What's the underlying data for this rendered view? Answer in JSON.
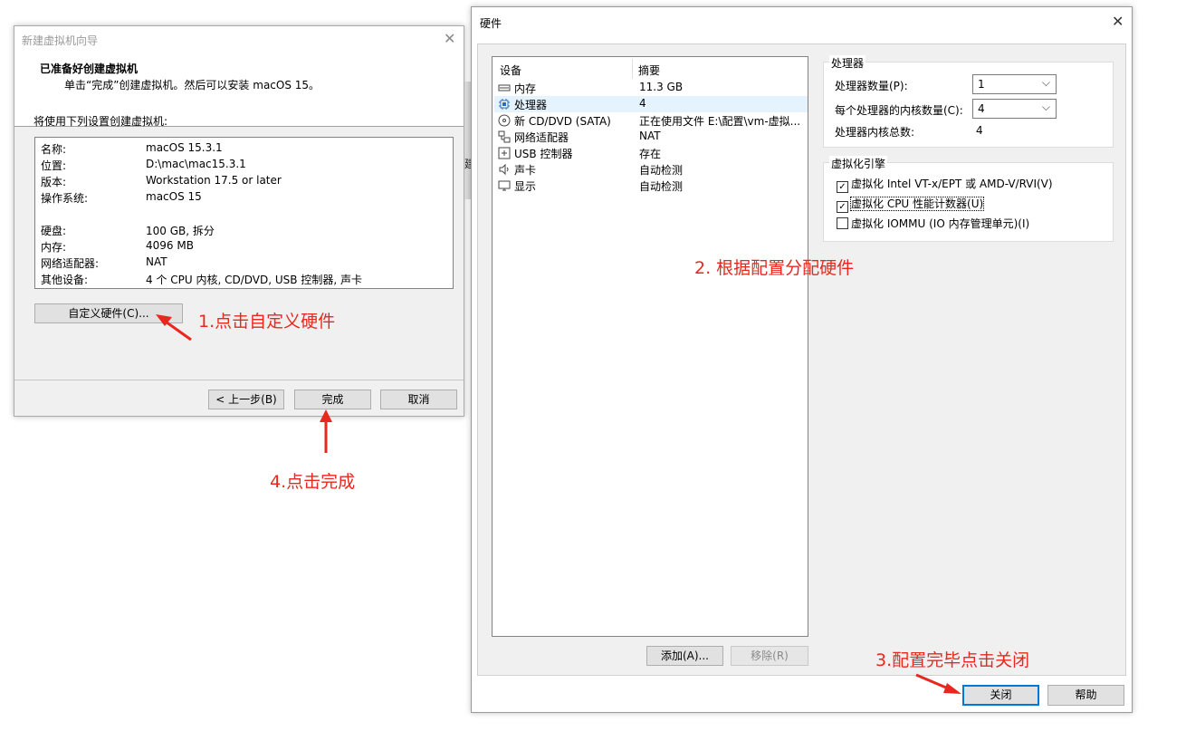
{
  "wizard": {
    "title": "新建虚拟机向导",
    "header_title": "已准备好创建虚拟机",
    "header_subtitle": "单击“完成”创建虚拟机。然后可以安装 macOS 15。",
    "prompt": "将使用下列设置创建虚拟机:",
    "settings": [
      {
        "key": "名称:",
        "value": "macOS 15.3.1"
      },
      {
        "key": "位置:",
        "value": "D:\\mac\\mac15.3.1"
      },
      {
        "key": "版本:",
        "value": "Workstation 17.5 or later"
      },
      {
        "key": "操作系统:",
        "value": "macOS 15"
      },
      {
        "key": "硬盘:",
        "value": "100 GB, 拆分"
      },
      {
        "key": "内存:",
        "value": "4096 MB"
      },
      {
        "key": "网络适配器:",
        "value": "NAT"
      },
      {
        "key": "其他设备:",
        "value": "4 个 CPU 内核, CD/DVD, USB 控制器, 声卡"
      }
    ],
    "customize_button": "自定义硬件(C)...",
    "back_button": "< 上一步(B)",
    "finish_button": "完成",
    "cancel_button": "取消"
  },
  "behind_window_char": "建",
  "hardware": {
    "title": "硬件",
    "list_headers": {
      "device": "设备",
      "summary": "摘要"
    },
    "devices": [
      {
        "name": "内存",
        "summary": "11.3 GB",
        "icon": "memory-icon"
      },
      {
        "name": "处理器",
        "summary": "4",
        "icon": "processor-icon"
      },
      {
        "name": "新 CD/DVD (SATA)",
        "summary": "正在使用文件 E:\\配置\\vm-虚拟...",
        "icon": "cd-dvd-icon"
      },
      {
        "name": "网络适配器",
        "summary": "NAT",
        "icon": "network-adapter-icon"
      },
      {
        "name": "USB 控制器",
        "summary": "存在",
        "icon": "usb-icon"
      },
      {
        "name": "声卡",
        "summary": "自动检测",
        "icon": "sound-card-icon"
      },
      {
        "name": "显示",
        "summary": "自动检测",
        "icon": "display-icon"
      }
    ],
    "selected_device": "处理器",
    "add_button": "添加(A)...",
    "remove_button": "移除(R)",
    "processor_group": {
      "title": "处理器",
      "count_label": "处理器数量(P):",
      "count_value": "1",
      "cores_label": "每个处理器的内核数量(C):",
      "cores_value": "4",
      "total_label": "处理器内核总数:",
      "total_value": "4"
    },
    "virtualization_group": {
      "title": "虚拟化引擎",
      "options": [
        {
          "label": "虚拟化 Intel VT-x/EPT 或 AMD-V/RVI(V)",
          "checked": true
        },
        {
          "label": "虚拟化 CPU 性能计数器(U)",
          "checked": true
        },
        {
          "label": "虚拟化 IOMMU (IO 内存管理单元)(I)",
          "checked": false
        }
      ]
    },
    "close_button": "关闭",
    "help_button": "帮助"
  },
  "annotations": {
    "step1": "1.点击自定义硬件",
    "step2": "2. 根据配置分配硬件",
    "step3": "3.配置完毕点击关闭",
    "step4": "4.点击完成",
    "color": "#e8281e"
  }
}
